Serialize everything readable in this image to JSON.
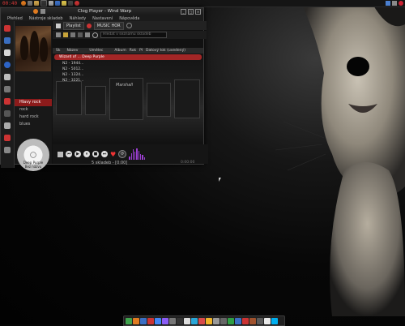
{
  "panel": {
    "clock": "00:40",
    "icons": [
      "fox-icon",
      "gear-icon",
      "folder-icon",
      "terminal-icon",
      "pen-icon",
      "network-icon",
      "star-icon",
      "media-icon",
      "record-icon"
    ],
    "tray": [
      "monitor-icon",
      "volume-icon",
      "power-icon"
    ]
  },
  "window": {
    "title": "Clog Player - Wind Warp",
    "menu": [
      "Přehled",
      "Nástroje skladeb",
      "Náhledy",
      "Nastavení",
      "Nápověda"
    ]
  },
  "toolbar": {
    "tab1": "Playlist",
    "tab2": "MUSIC HOR"
  },
  "search": {
    "placeholder": "Hledat v seznamu skladeb"
  },
  "table": {
    "columns": [
      "Sk",
      "Název",
      "Umělec",
      "Album",
      "Rok",
      "Pl",
      "Datový tok (uvedený)"
    ],
    "rows": [
      {
        "label": "Wizard of ... Deep Purple",
        "playing": true
      },
      {
        "label": "N2 - 1944...",
        "playing": false
      },
      {
        "label": "N2 - 5012...",
        "playing": false
      },
      {
        "label": "N2 - 1324...",
        "playing": false
      },
      {
        "label": "N2 - 3221...",
        "playing": false
      }
    ],
    "amp_label": "Marshall"
  },
  "library": {
    "items": [
      "Hlavy rock",
      "rock",
      "hard rock",
      "blues"
    ],
    "cd_label": "Deep Purple",
    "cd_sublabel": "Bez názvu"
  },
  "player": {
    "status": "5 skladeb - [0:00]",
    "time": "0:00:00",
    "viz_levels": [
      0.3,
      0.6,
      0.9,
      0.7,
      1.0,
      0.8,
      0.5,
      0.4,
      0.2
    ]
  },
  "dock": {
    "icons": [
      "globe-icon",
      "firefox-icon",
      "files-icon",
      "mail-icon",
      "chrome-icon",
      "music-icon",
      "camera-icon",
      "terminal-icon",
      "editor-icon",
      "chat-icon",
      "video-icon",
      "paint-icon",
      "trash-icon",
      "settings-icon",
      "download-icon",
      "network-icon",
      "record-icon",
      "photos-icon",
      "apps-icon",
      "calendar-icon",
      "skype-icon"
    ]
  }
}
